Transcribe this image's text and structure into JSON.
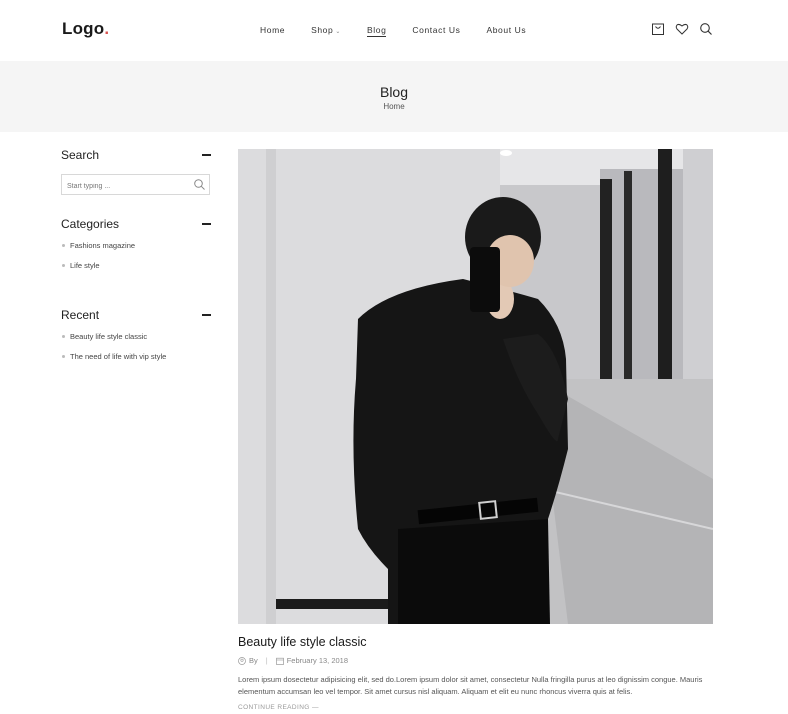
{
  "header": {
    "logo": "Logo",
    "logo_dot": ".",
    "nav": [
      {
        "label": "Home",
        "active": false
      },
      {
        "label": "Shop",
        "active": false,
        "has_dropdown": true
      },
      {
        "label": "Blog",
        "active": true
      },
      {
        "label": "Contact Us",
        "active": false
      },
      {
        "label": "About Us",
        "active": false
      }
    ],
    "icons": [
      "shopping-bag-icon",
      "heart-icon",
      "search-icon"
    ]
  },
  "page_banner": {
    "title": "Blog",
    "breadcrumb": "Home"
  },
  "sidebar": {
    "search": {
      "title": "Search",
      "placeholder": "Start typing ..."
    },
    "categories": {
      "title": "Categories",
      "items": [
        "Fashions magazine",
        "Life style"
      ]
    },
    "recent": {
      "title": "Recent",
      "items": [
        "Beauty life style classic",
        "The need of life with vip style"
      ]
    }
  },
  "post": {
    "title": "Beauty life style classic",
    "author_prefix": "By",
    "author": "",
    "date": "February 13, 2018",
    "excerpt": "Lorem ipsum dosectetur adipisicing elit, sed do.Lorem ipsum dolor sit amet, consectetur Nulla fringilla purus at leo dignissim congue. Mauris elementum accumsan leo vel tempor. Sit amet cursus nisl aliquam. Aliquam et elit eu nunc rhoncus viverra quis at felis.",
    "read_more": "CONTINUE READING",
    "read_more_arrow": "—",
    "image_alt": "man in black shirt taking mirror selfie"
  },
  "colors": {
    "accent_dot": "#d9534f",
    "banner_bg": "#f5f5f5",
    "text": "#222222"
  }
}
